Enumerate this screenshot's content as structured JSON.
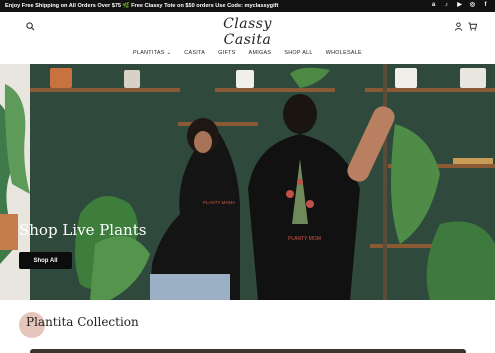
{
  "announcement": {
    "text": "Enjoy Free Shipping on All Orders Over $75 🌿 Free Classy Tote on $50 orders Use Code: myclassygift",
    "socials": [
      "amazon-icon",
      "tiktok-icon",
      "youtube-icon",
      "instagram-icon",
      "facebook-icon"
    ]
  },
  "brand": {
    "logo": "Classy Casita"
  },
  "nav": {
    "items": [
      "PLANTITAS ⌄",
      "CASITA",
      "GIFTS",
      "AMIGAS",
      "SHOP ALL",
      "WHOLESALE"
    ]
  },
  "hero": {
    "title": "Shop Live Plants",
    "button": "Shop All",
    "shirt_text_left": "PLANTY MAMA",
    "shirt_text_right": "PLANTY MOM"
  },
  "collection": {
    "title": "Plantita Collection"
  },
  "colors": {
    "announce_bg": "#121212",
    "hero_wall": "#2f4a3c",
    "button_bg": "#0c0c0c",
    "collection_circle": "#e6c6bc"
  }
}
